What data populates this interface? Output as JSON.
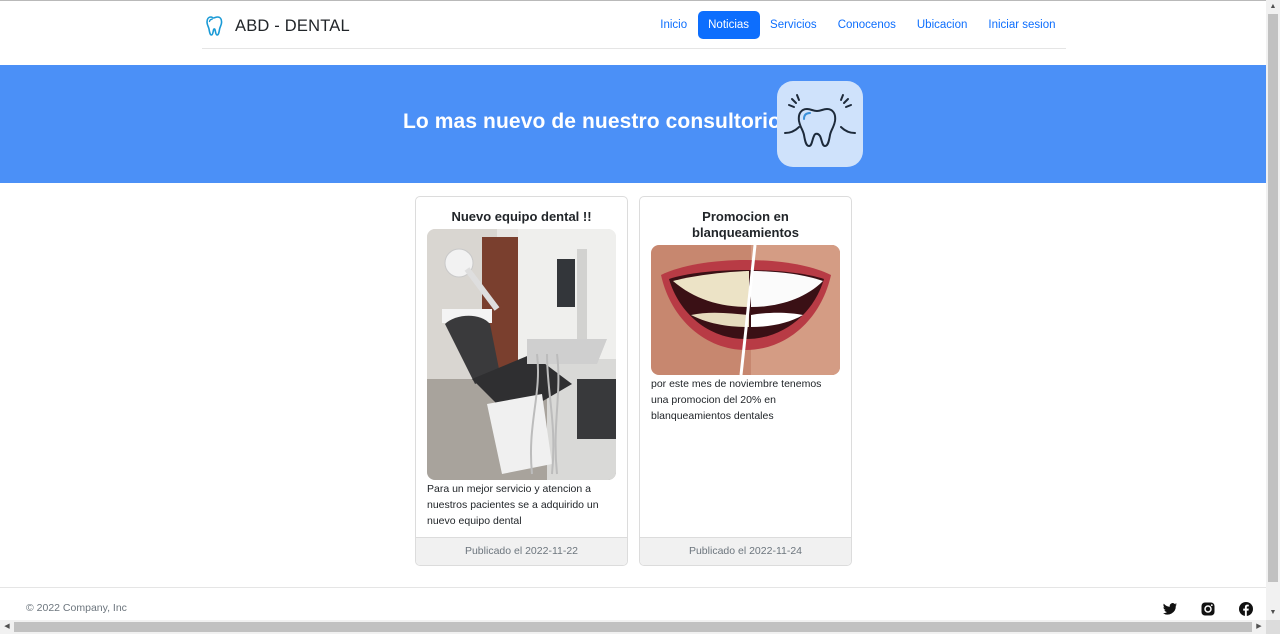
{
  "brand": {
    "name": "ABD - DENTAL",
    "logo_icon": "tooth-icon"
  },
  "nav": {
    "items": [
      {
        "label": "Inicio",
        "active": false
      },
      {
        "label": "Noticias",
        "active": true
      },
      {
        "label": "Servicios",
        "active": false
      },
      {
        "label": "Conocenos",
        "active": false
      },
      {
        "label": "Ubicacion",
        "active": false
      },
      {
        "label": "Iniciar sesion",
        "active": false
      }
    ]
  },
  "hero": {
    "title": "Lo mas nuevo de nuestro consultorio",
    "icon": "sparkling-tooth-icon",
    "background": "#4b90f7"
  },
  "news": [
    {
      "title": "Nuevo equipo dental !!",
      "image": "dental-chair-photo",
      "text": "Para un mejor servicio y atencion a nuestros pacientes se a adquirido un nuevo equipo dental",
      "footer": "Publicado el 2022-11-22"
    },
    {
      "title": "Promocion en blanqueamientos",
      "image": "teeth-whitening-photo",
      "text": "por este mes de noviembre tenemos una promocion del 20% en blanqueamientos dentales",
      "footer": "Publicado el 2022-11-24"
    }
  ],
  "footer": {
    "copyright": "© 2022 Company, Inc",
    "social": [
      "twitter-icon",
      "instagram-icon",
      "facebook-icon"
    ]
  },
  "colors": {
    "accent": "#0d6efd",
    "hero": "#4b90f7"
  }
}
